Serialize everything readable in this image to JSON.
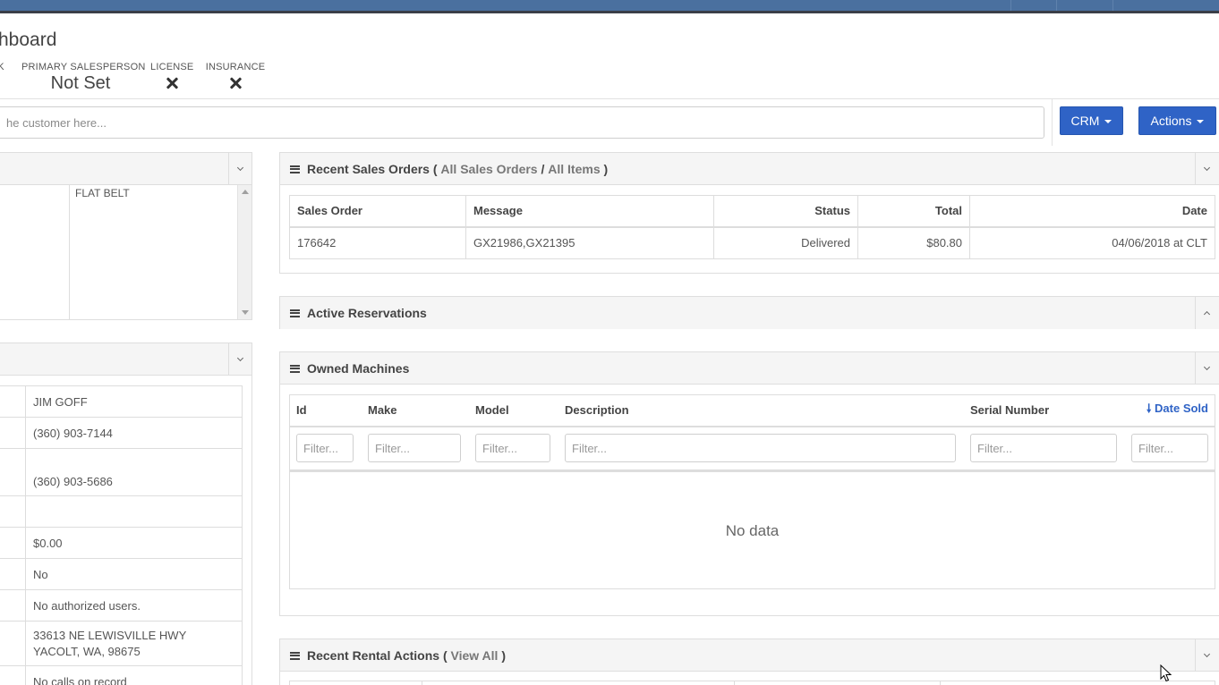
{
  "header": {
    "title": "hboard",
    "stats": [
      {
        "label": "IK",
        "value": ""
      },
      {
        "label": "PRIMARY SALESPERSON",
        "value": "Not Set"
      },
      {
        "label": "LICENSE",
        "value": "x-icon"
      },
      {
        "label": "INSURANCE",
        "value": "x-icon"
      }
    ]
  },
  "search": {
    "placeholder": "he customer here..."
  },
  "buttons": {
    "crm": "CRM",
    "actions": "Actions"
  },
  "left_top": {
    "flat_belt": "FLAT BELT"
  },
  "left_info": {
    "values": [
      "JIM GOFF",
      "(360) 903-7144",
      "(360) 903-5686",
      "",
      "$0.00",
      "No",
      "No authorized users.",
      "33613 NE LEWISVILLE HWY",
      "YACOLT, WA, 98675",
      "No calls on record"
    ]
  },
  "recent_sales": {
    "title": "Recent Sales Orders",
    "open_paren": "(",
    "link_all_orders": "All Sales Orders",
    "slash": "/",
    "link_all_items": "All Items",
    "close_paren": ")",
    "columns": [
      "Sales Order",
      "Message",
      "Status",
      "Total",
      "Date"
    ],
    "rows": [
      {
        "order": "176642",
        "message": "GX21986,GX21395",
        "status": "Delivered",
        "total": "$80.80",
        "date": "04/06/2018 at CLT"
      }
    ]
  },
  "active_reservations": {
    "title": "Active Reservations"
  },
  "owned_machines": {
    "title": "Owned Machines",
    "columns": [
      "Id",
      "Make",
      "Model",
      "Description",
      "Serial Number",
      "Date Sold"
    ],
    "sort_arrow": "🠗",
    "filter_placeholder": "Filter...",
    "empty": "No data"
  },
  "recent_rental": {
    "title": "Recent Rental Actions",
    "open_paren": "(",
    "link_view_all": "View All",
    "close_paren": ")"
  },
  "colors": {
    "accent": "#2f63c6",
    "topbar": "#4a709f"
  }
}
